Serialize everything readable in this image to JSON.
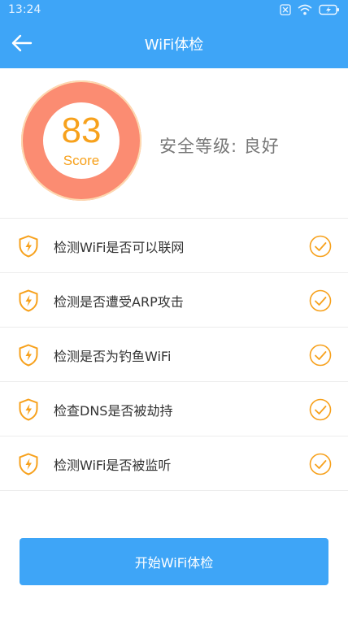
{
  "status_bar": {
    "time": "13:24",
    "icons": [
      "notification-box-icon",
      "wifi-icon",
      "battery-charging-icon"
    ]
  },
  "header": {
    "back_icon": "arrow-left-icon",
    "title": "WiFi体检"
  },
  "score": {
    "value": "83",
    "label": "Score",
    "level_text": "安全等级: 良好"
  },
  "checks": [
    {
      "label": "检测WiFi是否可以联网",
      "status_icon": "check-circle-icon"
    },
    {
      "label": "检测是否遭受ARP攻击",
      "status_icon": "check-circle-icon"
    },
    {
      "label": "检测是否为钓鱼WiFi",
      "status_icon": "check-circle-icon"
    },
    {
      "label": "检查DNS是否被劫持",
      "status_icon": "check-circle-icon"
    },
    {
      "label": "检测WiFi是否被监听",
      "status_icon": "check-circle-icon"
    }
  ],
  "actions": {
    "start_label": "开始WiFi体检"
  },
  "colors": {
    "primary": "#3ea5f7",
    "score_ring": "#fb8c72",
    "accent": "#f7a11c",
    "text": "#333333",
    "muted": "#777777"
  }
}
